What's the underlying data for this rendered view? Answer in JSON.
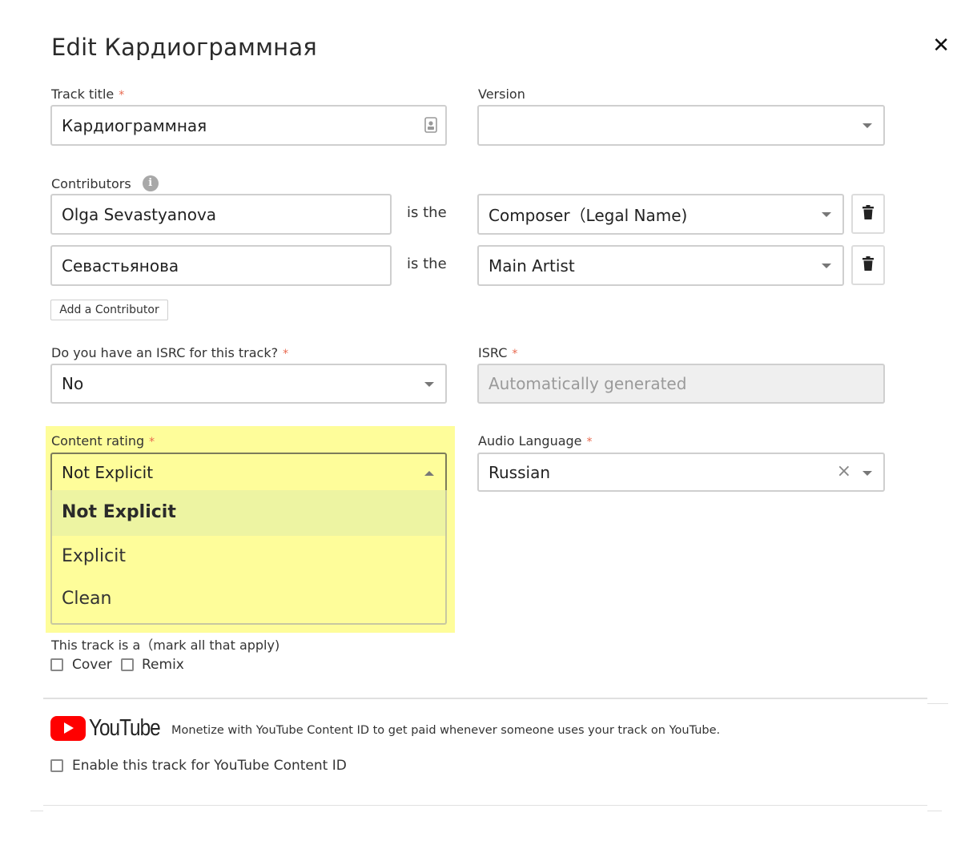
{
  "dialog": {
    "title": "Edit Кардиограммная",
    "close_glyph": "✕"
  },
  "track_title": {
    "label": "Track title",
    "required_mark": "*",
    "value": "Кардиограммная",
    "icon": "contact-card-icon"
  },
  "version": {
    "label": "Version",
    "value": ""
  },
  "contributors": {
    "label": "Contributors",
    "info_icon": "info-icon",
    "connector": "is the",
    "rows": [
      {
        "name": "Olga Sevastyanova",
        "role": "Composer（Legal Name)"
      },
      {
        "name": "Севастьянова",
        "role": "Main Artist"
      }
    ],
    "add_label": "Add a Contributor"
  },
  "isrc_question": {
    "label": "Do you have an ISRC for this track?",
    "required_mark": "*",
    "value": "No"
  },
  "isrc": {
    "label": "ISRC",
    "required_mark": "*",
    "value": "Automatically generated"
  },
  "content_rating": {
    "label": "Content rating",
    "required_mark": "*",
    "value": "Not Explicit",
    "options": [
      "Not Explicit",
      "Explicit",
      "Clean"
    ],
    "highlight_color": "#fefd9a"
  },
  "audio_language": {
    "label": "Audio Language",
    "required_mark": "*",
    "value": "Russian",
    "clear_glyph": "×"
  },
  "track_type": {
    "label": "This track is a（mark all that apply)",
    "options": [
      "Cover",
      "Remix"
    ]
  },
  "youtube": {
    "logo_text": "YouTube",
    "description": "Monetize with YouTube Content ID to get paid whenever someone uses your track on YouTube.",
    "enable_label": "Enable this track for YouTube Content ID",
    "brand_color": "#ff0000"
  }
}
